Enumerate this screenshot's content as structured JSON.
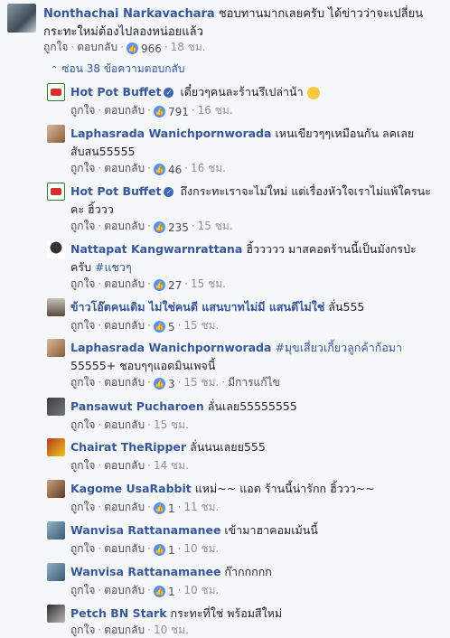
{
  "top_comment": {
    "author": "Nonthachai Narkavachara",
    "text": "ชอบทานมากเลยครับ ได้ข่าวว่าจะเปลี่ยนกระทะใหม่ต้องไปลองหน่อยแล้ว",
    "like_label": "ถูกใจ",
    "reply_label": "ตอบกลับ",
    "likes": "966",
    "time": "18 ชม."
  },
  "hide_replies": "ซ่อน 38 ข้อความตอบกลับ",
  "replies": [
    {
      "author": "Hot Pot Buffet",
      "verified": true,
      "text": "เดี๋ยวๆคนละร้านรึเปล่าน้า",
      "like_label": "ถูกใจ",
      "reply_label": "ตอบกลับ",
      "likes": "791",
      "time": "16 ชม."
    },
    {
      "author": "Laphasrada Wanichpornworada",
      "text": "เหนเขียวๆๆเหมือนกัน ลคเลยสับสน55555",
      "like_label": "ถูกใจ",
      "reply_label": "ตอบกลับ",
      "likes": "46",
      "time": "16 ชม."
    },
    {
      "author": "Hot Pot Buffet",
      "verified": true,
      "text": "ถึงกระทะเราจะไม่ใหม่ แต่เรื่องหัวใจเราไม่แพ้ใครนะคะ ฮิ้ววว",
      "like_label": "ถูกใจ",
      "reply_label": "ตอบกลับ",
      "likes": "235",
      "time": "15 ชม."
    },
    {
      "author": "Nattapat Kangwarnrattana",
      "text": "ฮิ้ววววว มาสคอตร้านนี้เป็นมังกรป่ะครับ",
      "hashtag": "#แชวๆ",
      "like_label": "ถูกใจ",
      "reply_label": "ตอบกลับ",
      "likes": "27",
      "time": "15 ชม."
    },
    {
      "author": "ข้าวโอ๊ตคนเดิม ไม่ใช่คนดี แสนบาทไม่มี แสนดีไม่ใช่",
      "text": "ลั่น555",
      "like_label": "ถูกใจ",
      "reply_label": "ตอบกลับ",
      "likes": "5",
      "time": "15 ชม."
    },
    {
      "author": "Laphasrada Wanichpornworada",
      "hashtag": "#มุขเสี่ยวเกี้ยวลูกค้าก้อมา",
      "text": "55555+ ชอบๆๆแอดมินเพจนี้",
      "like_label": "ถูกใจ",
      "reply_label": "ตอบกลับ",
      "likes": "3",
      "time": "15 ชม.",
      "edited": "มีการแก้ไข"
    },
    {
      "author": "Pansawut Pucharoen",
      "text": "ลั่นเลย55555555",
      "like_label": "ถูกใจ",
      "reply_label": "ตอบกลับ",
      "time": "15 ชม."
    },
    {
      "author": "Chairat TheRipper",
      "text": "ลั่นนนเลยย555",
      "like_label": "ถูกใจ",
      "reply_label": "ตอบกลับ",
      "time": "14 ชม."
    },
    {
      "author": "Kagome UsaRabbit",
      "text": "แหม่~~ แอด ร้านนี้น่ารักก ฮิ้ววว~~",
      "like_label": "ถูกใจ",
      "reply_label": "ตอบกลับ",
      "likes": "1",
      "time": "11 ชม."
    },
    {
      "author": "Wanvisa Rattanamanee",
      "text": "เข้ามาฮาคอมเม้นนี้",
      "like_label": "ถูกใจ",
      "reply_label": "ตอบกลับ",
      "likes": "1",
      "time": "10 ชม."
    },
    {
      "author": "Wanvisa Rattanamanee",
      "text": "ก๊ากกกกก",
      "like_label": "ถูกใจ",
      "reply_label": "ตอบกลับ",
      "likes": "1",
      "time": "10 ชม."
    },
    {
      "author": "Petch BN Stark",
      "text": "กระทะที่ใช่ พร้อมสีใหม่",
      "like_label": "ถูกใจ",
      "reply_label": "ตอบกลับ",
      "time": "10 ชม."
    }
  ]
}
